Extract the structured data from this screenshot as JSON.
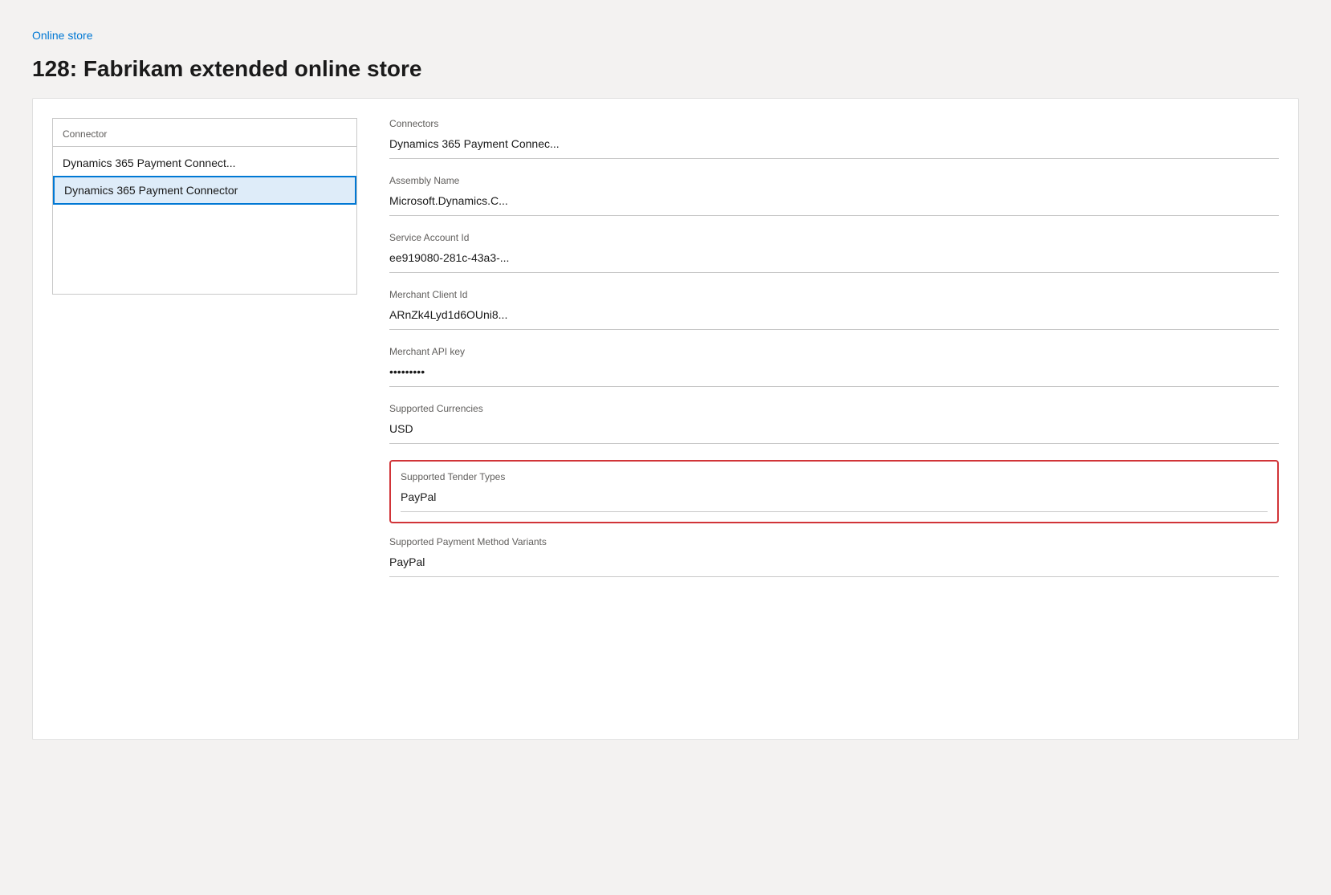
{
  "breadcrumb": {
    "label": "Online store",
    "link": "#"
  },
  "page": {
    "title": "128: Fabrikam extended online store"
  },
  "left_panel": {
    "connector_list_label": "Connector",
    "connector_items": [
      {
        "id": "item1",
        "label": "Dynamics 365 Payment Connect...",
        "selected": false
      },
      {
        "id": "item2",
        "label": "Dynamics 365 Payment Connector",
        "selected": true
      }
    ]
  },
  "right_panel": {
    "fields": [
      {
        "id": "connectors",
        "label": "Connectors",
        "value": "Dynamics 365 Payment Connec..."
      },
      {
        "id": "assembly_name",
        "label": "Assembly Name",
        "value": "Microsoft.Dynamics.C..."
      },
      {
        "id": "service_account_id",
        "label": "Service Account Id",
        "value": "ee919080-281c-43a3-..."
      },
      {
        "id": "merchant_client_id",
        "label": "Merchant Client Id",
        "value": "ARnZk4Lyd1d6OUni8..."
      },
      {
        "id": "merchant_api_key",
        "label": "Merchant API key",
        "value": "•••••••••"
      },
      {
        "id": "supported_currencies",
        "label": "Supported Currencies",
        "value": "USD"
      }
    ],
    "highlighted_field": {
      "label": "Supported Tender Types",
      "value": "PayPal"
    },
    "bottom_field": {
      "label": "Supported Payment Method Variants",
      "value": "PayPal"
    }
  }
}
